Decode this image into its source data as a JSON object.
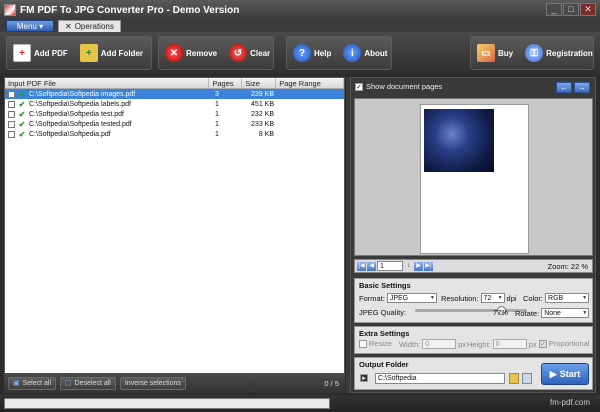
{
  "window": {
    "title": "FM PDF To JPG Converter Pro - Demo Version",
    "min": "_",
    "max": "□",
    "close": "✕"
  },
  "menu": {
    "menu_label": "Menu",
    "ops_tab": "Operations"
  },
  "toolbar": {
    "add_pdf": "Add PDF",
    "add_folder": "Add Folder",
    "remove": "Remove",
    "clear": "Clear",
    "help": "Help",
    "about": "About",
    "buy": "Buy",
    "registration": "Registration"
  },
  "filelist": {
    "headers": {
      "file": "Input PDF File",
      "pages": "Pages",
      "size": "Size",
      "range": "Page Range"
    },
    "rows": [
      {
        "path": "C:\\Softpedia\\Softpedia images.pdf",
        "pages": "3",
        "size": "239 KB"
      },
      {
        "path": "C:\\Softpedia\\Softpedia labels.pdf",
        "pages": "1",
        "size": "451 KB"
      },
      {
        "path": "C:\\Softpedia\\Softpedia test.pdf",
        "pages": "1",
        "size": "232 KB"
      },
      {
        "path": "C:\\Softpedia\\Softpedia tested.pdf",
        "pages": "1",
        "size": "233 KB"
      },
      {
        "path": "C:\\Softpedia\\Softpedia.pdf",
        "pages": "1",
        "size": "8 KB"
      }
    ],
    "select_all": "Select all",
    "deselect_all": "Deselect all",
    "inverse": "Inverse selections",
    "count": "0 / 5"
  },
  "preview": {
    "show_pages": "Show document pages",
    "page_number": "1",
    "zoom": "Zoom: 22 %"
  },
  "basic": {
    "title": "Basic Settings",
    "format_label": "Format:",
    "format_value": "JPEG",
    "resolution_label": "Resolution:",
    "resolution_value": "72",
    "dpi": "dpi",
    "color_label": "Color:",
    "color_value": "RGB",
    "quality_label": "JPEG Quality:",
    "quality_value": "77%",
    "quality_level": 0.77,
    "rotate_label": "Rotate:",
    "rotate_value": "None"
  },
  "extra": {
    "title": "Extra Settings",
    "resize": "Resize",
    "width_label": "Width:",
    "width_value": "0",
    "px": "px",
    "height_label": "Height:",
    "height_value": "0",
    "proportional": "Proportional"
  },
  "output": {
    "title": "Output Folder",
    "path": "C:\\Softpedia",
    "start": "Start"
  },
  "status": {
    "site": "fm-pdf.com"
  }
}
